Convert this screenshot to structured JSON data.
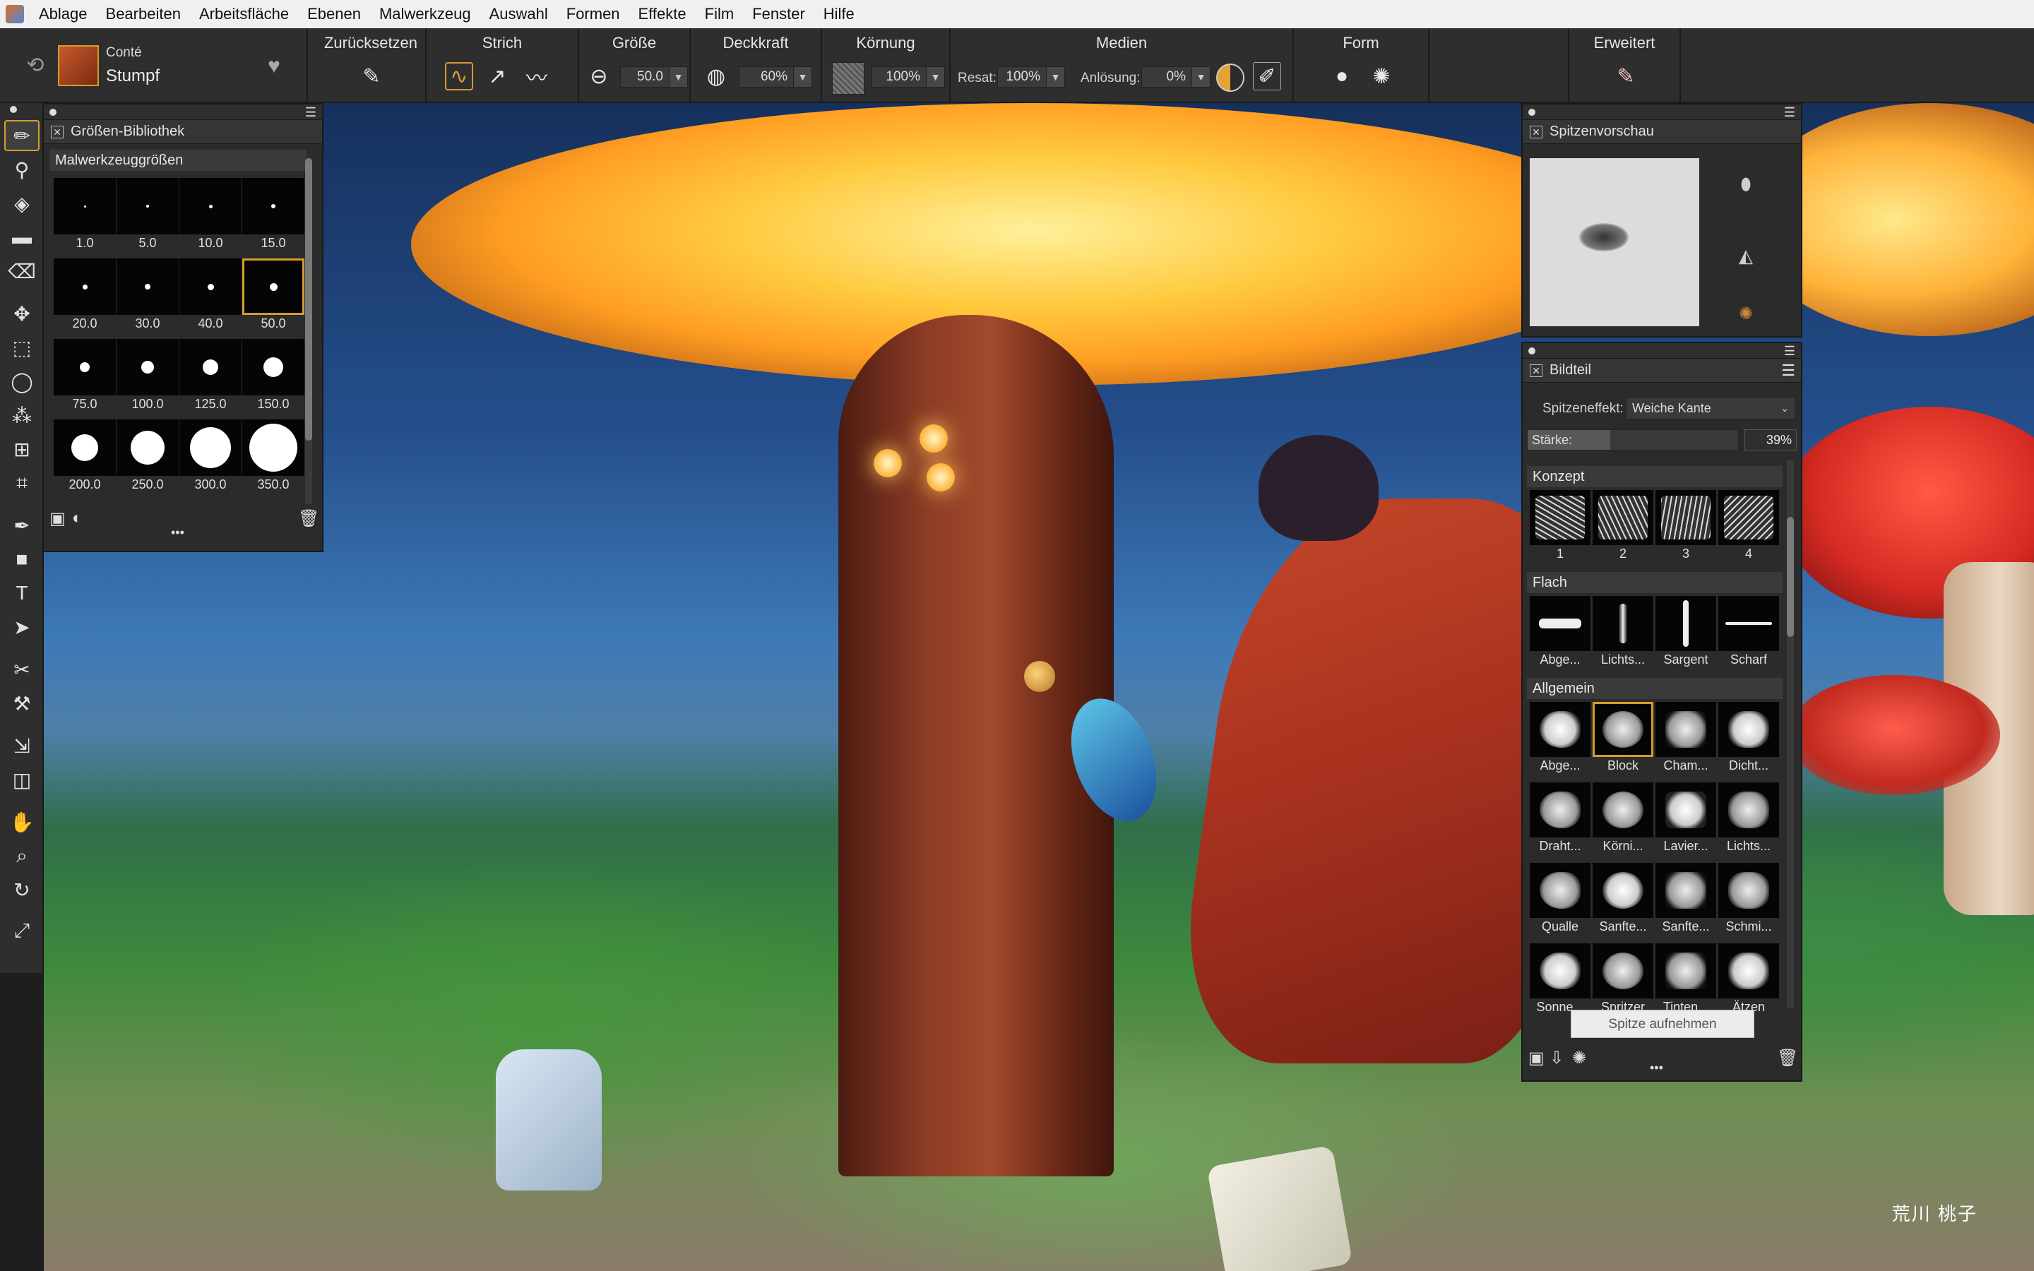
{
  "menu": [
    "Ablage",
    "Bearbeiten",
    "Arbeitsfläche",
    "Ebenen",
    "Malwerkzeug",
    "Auswahl",
    "Formen",
    "Effekte",
    "Film",
    "Fenster",
    "Hilfe"
  ],
  "brush": {
    "category": "Conté",
    "variant": "Stumpf"
  },
  "propbar": {
    "reset_label": "Zurücksetzen",
    "stroke_label": "Strich",
    "size_label": "Größe",
    "size_value": "50.0",
    "opacity_label": "Deckkraft",
    "opacity_value": "60%",
    "grain_label": "Körnung",
    "grain_value": "100%",
    "media_label": "Medien",
    "resat_label": "Resat:",
    "resat_value": "100%",
    "bleed_label": "Anlösung:",
    "bleed_value": "0%",
    "form_label": "Form",
    "advanced_label": "Erweitert"
  },
  "size_library": {
    "tab": "Größen-Bibliothek",
    "section": "Malwerkzeuggrößen",
    "sizes": [
      "1.0",
      "5.0",
      "10.0",
      "15.0",
      "20.0",
      "30.0",
      "40.0",
      "50.0",
      "75.0",
      "100.0",
      "125.0",
      "150.0",
      "200.0",
      "250.0",
      "300.0",
      "350.0"
    ],
    "selected": "50.0"
  },
  "dab_preview": {
    "tab": "Spitzenvorschau"
  },
  "dab_library": {
    "tab": "Bildteil",
    "effect_label": "Spitzeneffekt:",
    "effect_value": "Weiche Kante",
    "strength_label": "Stärke:",
    "strength_value": "39%",
    "strength_fraction": 0.39,
    "sections": [
      {
        "title": "Konzept",
        "items": [
          "1",
          "2",
          "3",
          "4"
        ]
      },
      {
        "title": "Flach",
        "items": [
          "Abge...",
          "Lichts...",
          "Sargent",
          "Scharf"
        ]
      },
      {
        "title": "Allgemein",
        "items": [
          "Abge...",
          "Block",
          "Cham...",
          "Dicht...",
          "Draht...",
          "Körni...",
          "Lavier...",
          "Lichts...",
          "Qualle",
          "Sanfte...",
          "Sanfte...",
          "Schmi...",
          "Sonne...",
          "Spritzer",
          "Tinten...",
          "Ätzen"
        ]
      }
    ],
    "selected": "Block",
    "capture_button": "Spitze aufnehmen"
  },
  "signature": "荒川 桃子",
  "colors": {
    "accent": "#d79b2d",
    "panel": "#2b2b2b",
    "menubar": "#f0f0f0"
  }
}
